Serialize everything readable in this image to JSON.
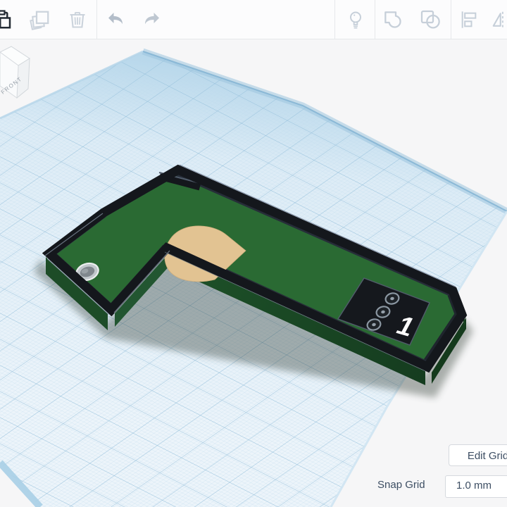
{
  "toolbar": {
    "icons": [
      {
        "name": "paste"
      },
      {
        "name": "duplicate"
      },
      {
        "name": "delete"
      },
      {
        "name": "undo"
      },
      {
        "name": "redo"
      },
      {
        "name": "toggle-visibility"
      },
      {
        "name": "group"
      },
      {
        "name": "ungroup"
      },
      {
        "name": "align"
      },
      {
        "name": "flip"
      }
    ]
  },
  "viewcube": {
    "front_label": "FRONT"
  },
  "scene": {
    "object": "mini-golf-hole",
    "hole_number": "1",
    "tee_marker_count": 3
  },
  "grid_controls": {
    "edit_grid_label": "Edit Grid",
    "snap_grid_label": "Snap Grid",
    "snap_grid_value": "1.0 mm"
  },
  "colors": {
    "background": "#f6f6f7",
    "toolbar_bg": "#fcfcfd",
    "grid_major": "#8fbcd8",
    "grid_fine": "#bcd8ea",
    "course_green": "#2a6a33",
    "wall_black": "#14171c",
    "obstacle_tan": "#e2c392",
    "tee_square": "#15181d",
    "ui_text": "#3d4e63"
  }
}
